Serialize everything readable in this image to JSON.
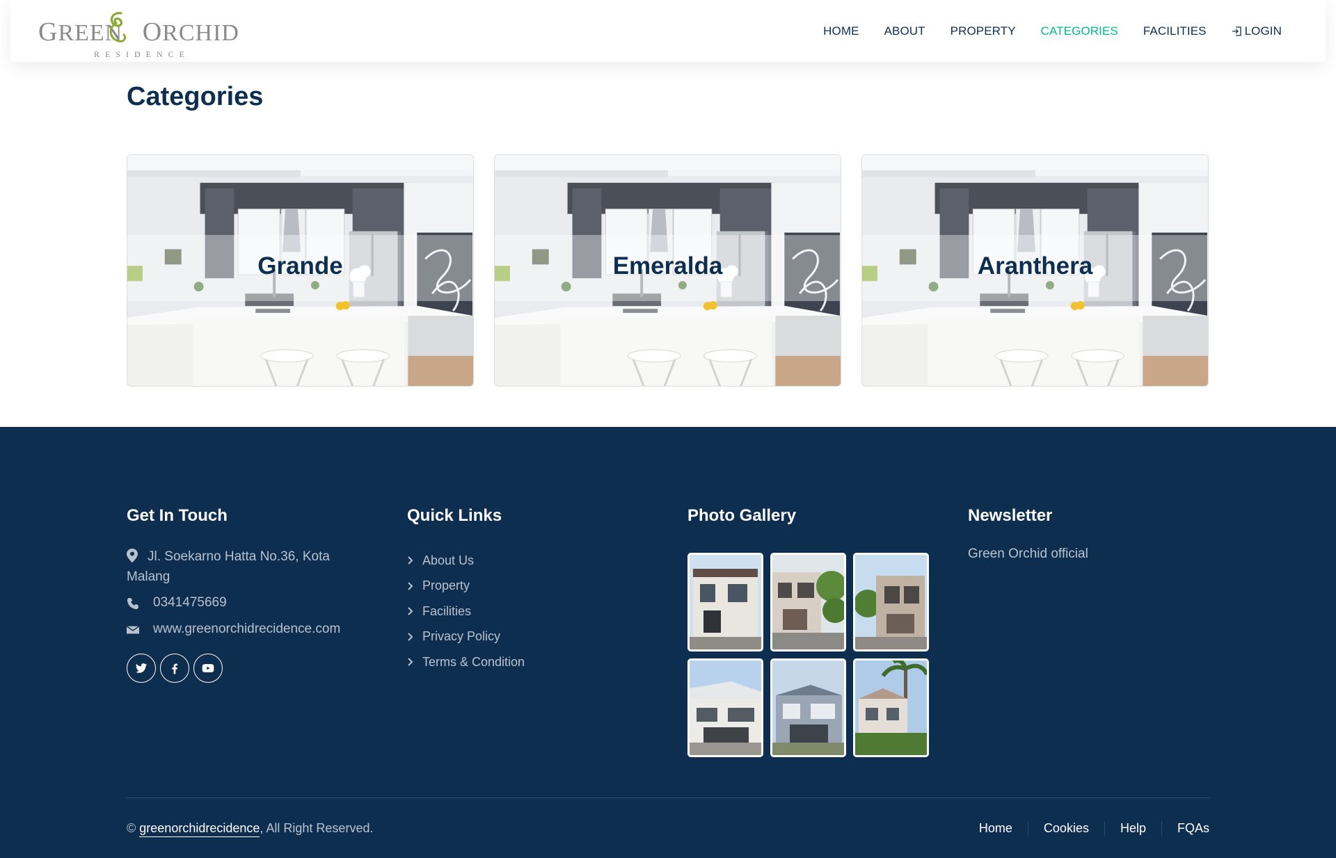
{
  "brand": {
    "wordmark_left": "GREEN",
    "wordmark_right": "ORCHID",
    "tagline": "RESIDENCE"
  },
  "nav": {
    "items": [
      {
        "label": "HOME"
      },
      {
        "label": "ABOUT"
      },
      {
        "label": "PROPERTY"
      },
      {
        "label": "CATEGORIES",
        "active": true
      },
      {
        "label": "FACILITIES"
      },
      {
        "label": "LOGIN"
      }
    ]
  },
  "page": {
    "title": "Categories"
  },
  "categories": [
    {
      "name": "Grande"
    },
    {
      "name": "Emeralda"
    },
    {
      "name": "Aranthera"
    }
  ],
  "footer": {
    "contact": {
      "title": "Get In Touch",
      "address": "Jl. Soekarno Hatta No.36, Kota Malang",
      "phone": "0341475669",
      "website": "www.greenorchidrecidence.com",
      "socials": [
        "twitter-icon",
        "facebook-icon",
        "youtube-icon"
      ]
    },
    "quick_links": {
      "title": "Quick Links",
      "items": [
        "About Us",
        "Property",
        "Facilities",
        "Privacy Policy",
        "Terms & Condition"
      ]
    },
    "gallery": {
      "title": "Photo Gallery"
    },
    "newsletter": {
      "title": "Newsletter",
      "text": "Green Orchid official"
    },
    "copyright": {
      "prefix": "©",
      "site": "greenorchidrecidence",
      "suffix": ", All Right Reserved."
    },
    "menu": [
      "Home",
      "Cookies",
      "Help",
      "FQAs"
    ]
  },
  "colors": {
    "primary": "#0e2e50",
    "accent": "#00b98e",
    "footer_text": "#b8c2cf"
  }
}
